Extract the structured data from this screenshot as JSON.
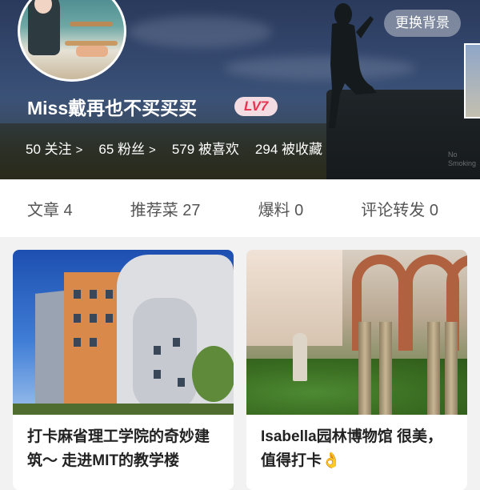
{
  "profile": {
    "change_bg_label": "更换背景",
    "username": "Miss戴再也不买买买",
    "level_badge": "LV7",
    "watermark": "No Smoking",
    "stats": [
      {
        "label": "50 关注",
        "chevron": ">"
      },
      {
        "label": "65 粉丝",
        "chevron": ">"
      },
      {
        "label": "579 被喜欢",
        "chevron": ""
      },
      {
        "label": "294 被收藏",
        "chevron": ""
      }
    ]
  },
  "tabs": [
    {
      "label": "文章 4"
    },
    {
      "label": "推荐菜 27"
    },
    {
      "label": "爆料 0"
    },
    {
      "label": "评论转发 0"
    }
  ],
  "cards": [
    {
      "title": "打卡麻省理工学院的奇妙建筑～ 走进MIT的教学楼",
      "image": "mit-stata-center-photo"
    },
    {
      "title": "Isabella园林博物馆 很美，值得打卡👌",
      "image": "isabella-garden-museum-photo"
    }
  ],
  "colors": {
    "accent_red": "#e8324f",
    "badge_bg": "#f3dde3",
    "page_bg": "#f2f2f2"
  }
}
